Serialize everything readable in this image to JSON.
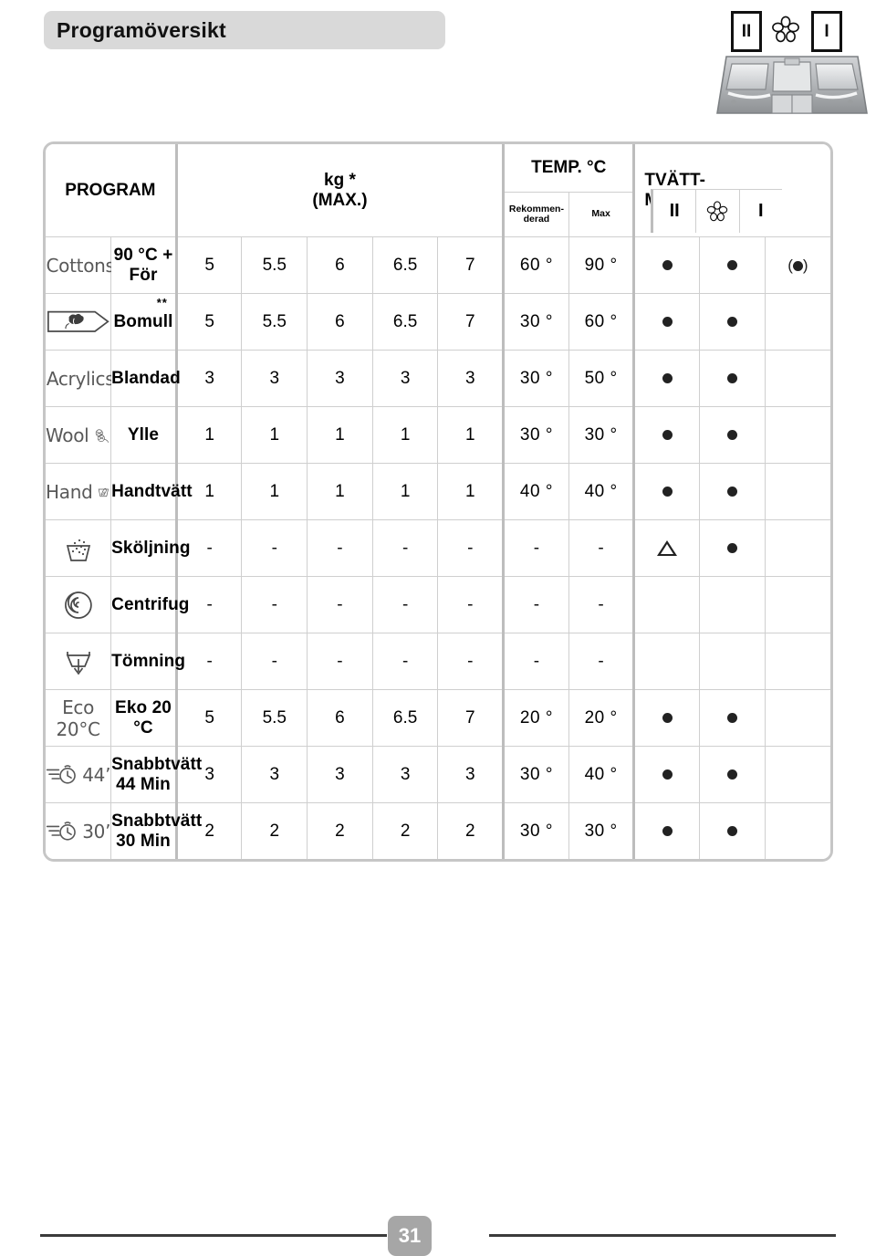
{
  "page": {
    "title": "Programöversikt",
    "page_number": "31"
  },
  "drawer": {
    "compartment_ii_label": "II",
    "compartment_i_label": "I",
    "softener_icon": "flower-icon"
  },
  "table": {
    "headers": {
      "program": "PROGRAM",
      "kg_line1": "kg *",
      "kg_line2": "(MAX.)",
      "temp": "TEMP. °C",
      "temp_recommended": "Rekommen-\nderad",
      "temp_max": "Max",
      "detergent_line1": "TVÄTT-",
      "detergent_line2": "MEDEL",
      "det_ii": "II",
      "det_flower": "flower-icon",
      "det_i": "I"
    },
    "rows": [
      {
        "icon": "cottons-prewash-icon",
        "icon_word": "Cottons",
        "program": "90 °C + För",
        "asterisks": "",
        "kg": [
          "5",
          "5.5",
          "6",
          "6.5",
          "7"
        ],
        "temp_rec": "60 °",
        "temp_max": "90 °",
        "det_ii": "dot",
        "det_flower": "dot",
        "det_i": "dot-paren"
      },
      {
        "icon": "cotton-boll-arrow-icon",
        "icon_word": "",
        "program": "Bomull",
        "asterisks": "**",
        "kg": [
          "5",
          "5.5",
          "6",
          "6.5",
          "7"
        ],
        "temp_rec": "30 °",
        "temp_max": "60 °",
        "det_ii": "dot",
        "det_flower": "dot",
        "det_i": ""
      },
      {
        "icon": "acrylics-triangle-icon",
        "icon_word": "Acrylics",
        "program": "Blandad",
        "asterisks": "",
        "kg": [
          "3",
          "3",
          "3",
          "3",
          "3"
        ],
        "temp_rec": "30 °",
        "temp_max": "50 °",
        "det_ii": "dot",
        "det_flower": "dot",
        "det_i": ""
      },
      {
        "icon": "wool-yarn-icon",
        "icon_word": "Wool",
        "program": "Ylle",
        "asterisks": "",
        "kg": [
          "1",
          "1",
          "1",
          "1",
          "1"
        ],
        "temp_rec": "30 °",
        "temp_max": "30 °",
        "det_ii": "dot",
        "det_flower": "dot",
        "det_i": ""
      },
      {
        "icon": "handwash-icon",
        "icon_word": "Hand",
        "program": "Handtvätt",
        "asterisks": "",
        "kg": [
          "1",
          "1",
          "1",
          "1",
          "1"
        ],
        "temp_rec": "40 °",
        "temp_max": "40 °",
        "det_ii": "dot",
        "det_flower": "dot",
        "det_i": ""
      },
      {
        "icon": "rinse-icon",
        "icon_word": "",
        "program": "Sköljning",
        "asterisks": "",
        "kg": [
          "-",
          "-",
          "-",
          "-",
          "-"
        ],
        "temp_rec": "-",
        "temp_max": "-",
        "det_ii": "triangle",
        "det_flower": "dot",
        "det_i": ""
      },
      {
        "icon": "spin-spiral-icon",
        "icon_word": "",
        "program": "Centrifug",
        "asterisks": "",
        "kg": [
          "-",
          "-",
          "-",
          "-",
          "-"
        ],
        "temp_rec": "-",
        "temp_max": "-",
        "det_ii": "",
        "det_flower": "",
        "det_i": ""
      },
      {
        "icon": "drain-icon",
        "icon_word": "",
        "program": "Tömning",
        "asterisks": "",
        "kg": [
          "-",
          "-",
          "-",
          "-",
          "-"
        ],
        "temp_rec": "-",
        "temp_max": "-",
        "det_ii": "",
        "det_flower": "",
        "det_i": ""
      },
      {
        "icon": "eco-20c-icon",
        "icon_word": "Eco 20°C",
        "program": "Eko 20 °C",
        "asterisks": "",
        "kg": [
          "5",
          "5.5",
          "6",
          "6.5",
          "7"
        ],
        "temp_rec": "20 °",
        "temp_max": "20 °",
        "det_ii": "dot",
        "det_flower": "dot",
        "det_i": ""
      },
      {
        "icon": "quick-wash-44-icon",
        "icon_word": "44’",
        "program": "Snabbtvätt 44 Min",
        "asterisks": "",
        "kg": [
          "3",
          "3",
          "3",
          "3",
          "3"
        ],
        "temp_rec": "30 °",
        "temp_max": "40 °",
        "det_ii": "dot",
        "det_flower": "dot",
        "det_i": ""
      },
      {
        "icon": "quick-wash-30-icon",
        "icon_word": "30’",
        "program": "Snabbtvätt 30 Min",
        "asterisks": "",
        "kg": [
          "2",
          "2",
          "2",
          "2",
          "2"
        ],
        "temp_rec": "30 °",
        "temp_max": "30 °",
        "det_ii": "dot",
        "det_flower": "dot",
        "det_i": ""
      }
    ]
  },
  "colors": {
    "banner_bg": "#d9d9d9",
    "grid_line": "#cfcfcf",
    "thick_line": "#bdbdbd",
    "icon_gray": "#595959",
    "page_badge_bg": "#a6a6a6"
  }
}
